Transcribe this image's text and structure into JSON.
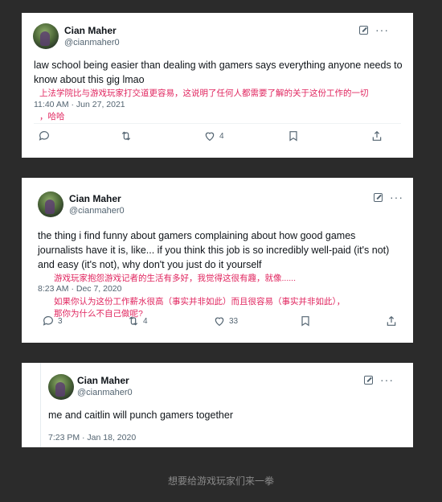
{
  "tweets": [
    {
      "name": "Cian Maher",
      "handle": "@cianmaher0",
      "text": "law school being easier than dealing with gamers says everything anyone needs to know about this gig lmao",
      "translation_lines": [
        "上法学院比与游戏玩家打交道更容易，这说明了任何人都需要了解的关于这份工作的一切",
        "，哈哈"
      ],
      "timestamp": "11:40 AM · Jun 27, 2021",
      "reply_count": "",
      "retweet_count": "",
      "like_count": "4"
    },
    {
      "name": "Cian Maher",
      "handle": "@cianmaher0",
      "text": "the thing i find funny about gamers complaining about how good games journalists have it is, like... if you think this job is so incredibly well-paid (it's not) and easy (it's not), why don't you just do it yourself",
      "translation_lines": [
        "游戏玩家抱怨游戏记者的生活有多好，我觉得这很有趣，就像......",
        "如果你认为这份工作薪水很高（事实并非如此）而且很容易（事实并非如此），",
        "那你为什么不自己做呢?"
      ],
      "timestamp": "8:23 AM · Dec 7, 2020",
      "reply_count": "3",
      "retweet_count": "4",
      "like_count": "33"
    },
    {
      "name": "Cian Maher",
      "handle": "@cianmaher0",
      "text": "me and caitlin will punch gamers together",
      "timestamp": "7:23 PM · Jan 18, 2020"
    }
  ],
  "caption": "想要给游戏玩家们来一拳",
  "icons": [
    "reply-icon",
    "retweet-icon",
    "like-icon",
    "bookmark-icon",
    "share-icon",
    "grok-icon",
    "more-icon"
  ],
  "colors": {
    "translation": "#e0245e",
    "secondary": "#536471",
    "background": "#2b2b2b"
  }
}
